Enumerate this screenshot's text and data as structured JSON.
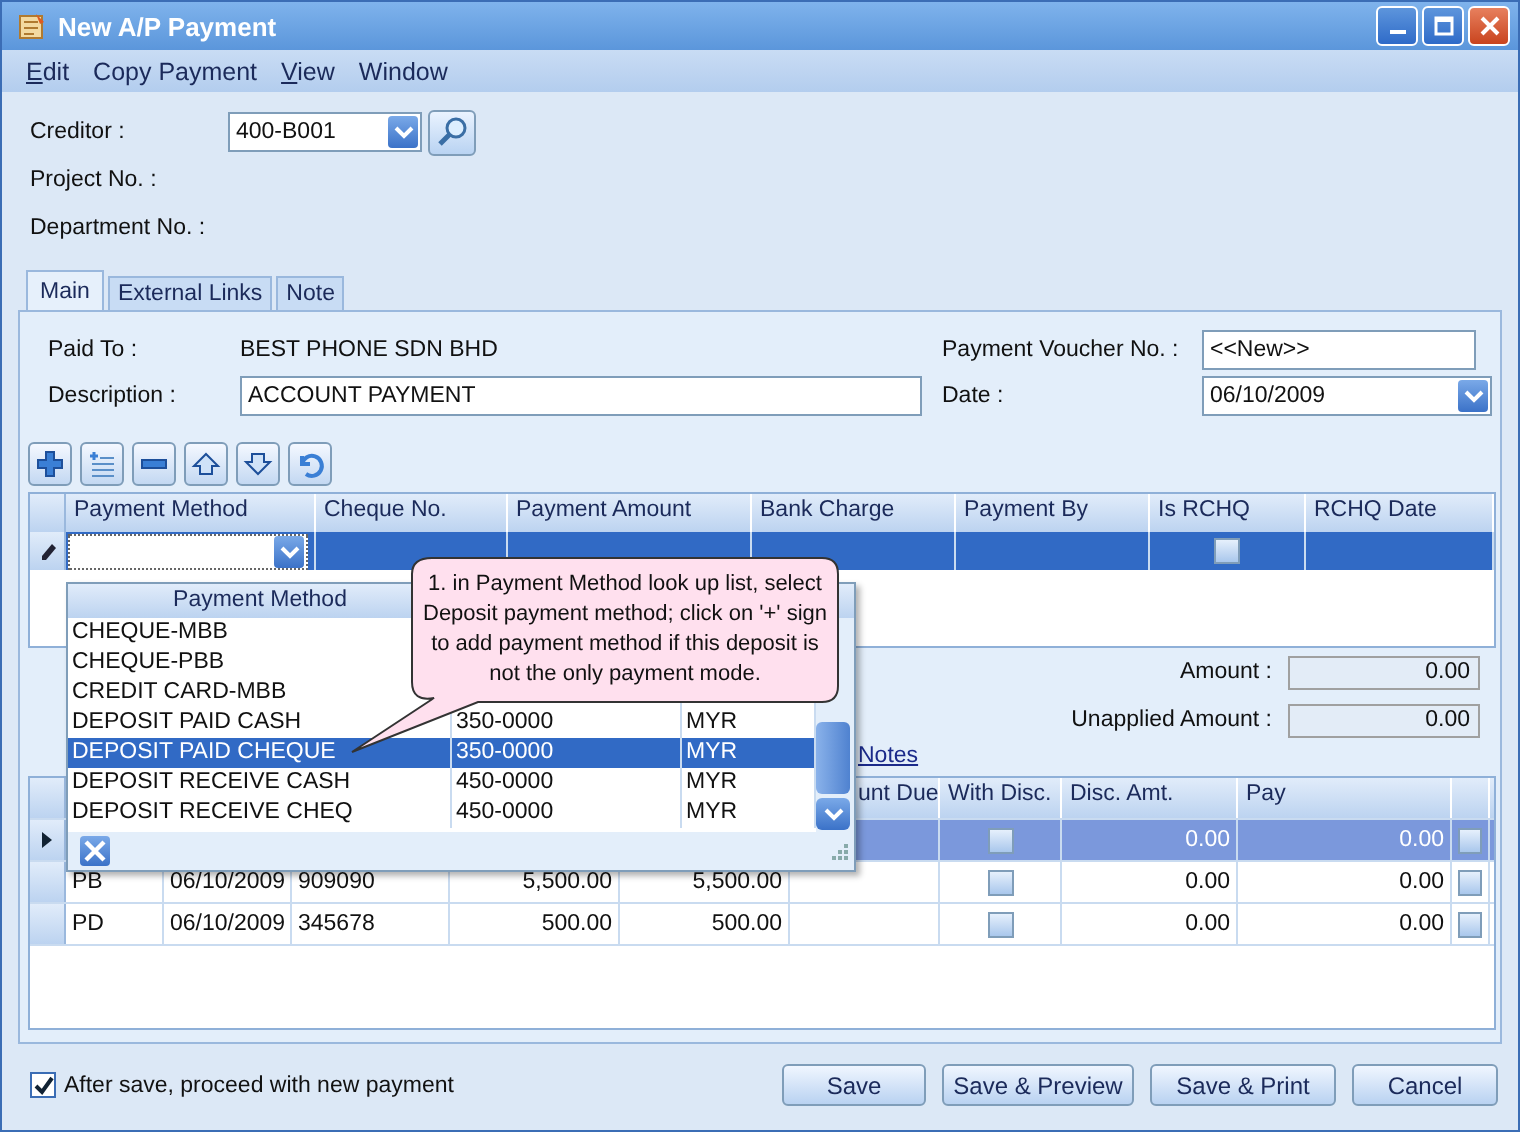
{
  "window": {
    "title": "New A/P Payment"
  },
  "menu": [
    {
      "label": "Edit",
      "underline_first": true
    },
    {
      "label": "Copy Payment",
      "underline_first": false
    },
    {
      "label": "View",
      "underline_first": true
    },
    {
      "label": "Window",
      "underline_first": false
    }
  ],
  "header_fields": {
    "creditor": {
      "label": "Creditor :",
      "value": "400-B001"
    },
    "project": {
      "label": "Project No. :"
    },
    "department": {
      "label": "Department No. :"
    }
  },
  "tabs": [
    {
      "label": "Main",
      "selected": true
    },
    {
      "label": "External Links",
      "selected": false
    },
    {
      "label": "Note",
      "selected": false
    }
  ],
  "main": {
    "paid_to": {
      "label": "Paid To :",
      "value": "BEST PHONE SDN BHD"
    },
    "description": {
      "label": "Description :",
      "value": "ACCOUNT PAYMENT"
    },
    "voucher": {
      "label": "Payment Voucher No. :",
      "value": "<<New>>"
    },
    "date": {
      "label": "Date :",
      "value": "06/10/2009"
    }
  },
  "payment_grid": {
    "columns": [
      "Payment Method",
      "Cheque No.",
      "Payment Amount",
      "Bank Charge",
      "Payment By",
      "Is RCHQ",
      "RCHQ Date"
    ],
    "rows": [
      {
        "selected": true,
        "editing": true,
        "is_rchq": false
      }
    ]
  },
  "amount": {
    "label": "Amount :",
    "value": "0.00"
  },
  "unapplied": {
    "label": "Unapplied Amount :",
    "value": "0.00"
  },
  "notes_link": "Notes",
  "invoice_grid": {
    "columns": [
      "unt Due",
      "With Disc.",
      "Disc. Amt.",
      "Pay"
    ],
    "rows": [
      {
        "selected": true,
        "with_disc": false,
        "disc_amt": "0.00",
        "pay": "0.00",
        "paid": false
      },
      {
        "selected": false,
        "column_1": "PB",
        "column_2": "06/10/2009",
        "column_3": "909090",
        "column_4": "5,500.00",
        "column_5": "5,500.00",
        "with_disc": false,
        "disc_amt": "0.00",
        "pay": "0.00",
        "paid": false
      },
      {
        "selected": false,
        "column_1": "PD",
        "column_2": "06/10/2009",
        "column_3": "345678",
        "column_4": "500.00",
        "column_5": "500.00",
        "with_disc": false,
        "disc_amt": "0.00",
        "pay": "0.00",
        "paid": false
      }
    ]
  },
  "lookup": {
    "column": "Payment Method",
    "rows": [
      {
        "method": "CHEQUE-MBB",
        "selected": false
      },
      {
        "method": "CHEQUE-PBB",
        "selected": false
      },
      {
        "method": "CREDIT CARD-MBB",
        "selected": false
      },
      {
        "method": "DEPOSIT PAID CASH",
        "account": "350-0000",
        "currency": "MYR",
        "selected": false
      },
      {
        "method": "DEPOSIT PAID CHEQUE",
        "account": "350-0000",
        "currency": "MYR",
        "selected": true
      },
      {
        "method": "DEPOSIT RECEIVE CASH",
        "account": "450-0000",
        "currency": "MYR",
        "selected": false
      },
      {
        "method": "DEPOSIT RECEIVE CHEQ",
        "account": "450-0000",
        "currency": "MYR",
        "selected": false
      }
    ]
  },
  "callout": "1. in Payment Method look up list, select Deposit payment method; click on '+' sign to add payment method if this deposit is not the only payment mode.",
  "after_save": {
    "label": "After save, proceed with new payment",
    "checked": true
  },
  "buttons": [
    "Save",
    "Save & Preview",
    "Save & Print",
    "Cancel"
  ]
}
